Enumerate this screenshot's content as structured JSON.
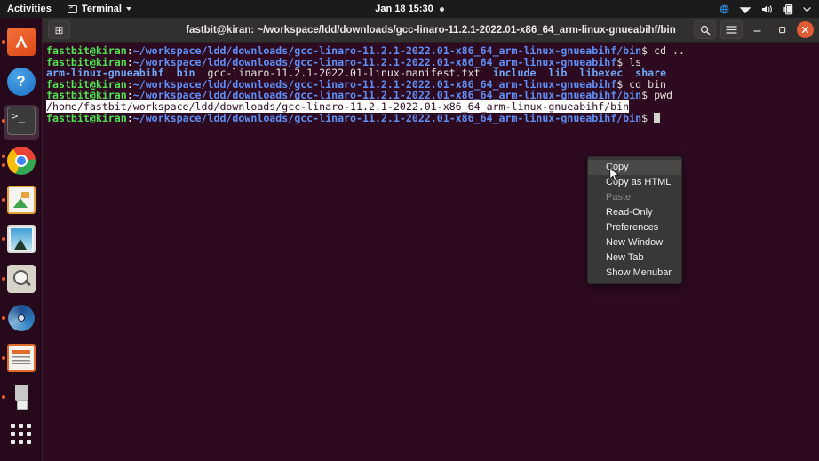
{
  "topbar": {
    "activities": "Activities",
    "app_menu": "Terminal",
    "app_menu_icon": "terminal-icon",
    "caret_icon": "chevron-down-icon",
    "clock": "Jan 18  15:30",
    "clock_dot_icon": "notification-dot-icon",
    "tray": [
      {
        "name": "network-vpn-icon",
        "glyph": "⎈"
      },
      {
        "name": "wifi-icon",
        "glyph": "▼"
      },
      {
        "name": "volume-icon",
        "glyph": "🔊"
      },
      {
        "name": "battery-icon",
        "glyph": "❙"
      },
      {
        "name": "system-menu-caret-icon",
        "glyph": "▾"
      }
    ]
  },
  "dock": {
    "items": [
      {
        "label": "Ubuntu Software",
        "icon": "ubuntu-software-icon",
        "glyph": "A",
        "running": true,
        "active": false
      },
      {
        "label": "Help",
        "icon": "help-icon",
        "glyph": "?",
        "running": false,
        "active": false
      },
      {
        "label": "Terminal",
        "icon": "terminal-icon",
        "glyph": ">_",
        "running": true,
        "active": true
      },
      {
        "label": "Google Chrome",
        "icon": "chrome-icon",
        "glyph": "",
        "running": true,
        "active": false
      },
      {
        "label": "LibreOffice Draw",
        "icon": "libreoffice-draw-icon",
        "glyph": "",
        "running": true,
        "active": false
      },
      {
        "label": "Image Viewer",
        "icon": "image-viewer-icon",
        "glyph": "",
        "running": true,
        "active": false
      },
      {
        "label": "Magnifier",
        "icon": "magnifier-icon",
        "glyph": "",
        "running": true,
        "active": false
      },
      {
        "label": "Media Player",
        "icon": "spiral-media-icon",
        "glyph": "",
        "running": true,
        "active": false
      },
      {
        "label": "LibreOffice Impress",
        "icon": "libreoffice-impress-icon",
        "glyph": "",
        "running": true,
        "active": false
      },
      {
        "label": "USB Drive",
        "icon": "usb-drive-icon",
        "glyph": "",
        "running": true,
        "active": false
      }
    ],
    "app_grid_label": "Show Applications",
    "app_grid_icon": "app-grid-icon"
  },
  "window": {
    "title": "fastbit@kiran: ~/workspace/ldd/downloads/gcc-linaro-11.2.1-2022.01-x86_64_arm-linux-gnueabihf/bin",
    "new_tab_icon": "new-tab-icon",
    "search_icon": "search-icon",
    "menu_icon": "hamburger-menu-icon",
    "minimize_icon": "minimize-icon",
    "maximize_icon": "maximize-icon",
    "close_icon": "close-icon",
    "new_tab_glyph": "⊞",
    "search_glyph": "⚲",
    "menu_glyph": "≡",
    "minimize_glyph": "–",
    "maximize_glyph": "❑",
    "close_glyph": "×"
  },
  "terminal": {
    "user_host": "fastbit@kiran",
    "lines": [
      {
        "type": "prompt",
        "user": "fastbit@kiran",
        "colon": ":",
        "path": "~/workspace/ldd/downloads/gcc-linaro-11.2.1-2022.01-x86_64_arm-linux-gnueabihf/bin",
        "sigil": "$ ",
        "command": "cd .."
      },
      {
        "type": "prompt",
        "user": "fastbit@kiran",
        "colon": ":",
        "path": "~/workspace/ldd/downloads/gcc-linaro-11.2.1-2022.01-x86_64_arm-linux-gnueabihf",
        "sigil": "$ ",
        "command": "ls"
      },
      {
        "type": "ls-output",
        "entries": [
          {
            "name": "arm-linux-gnueabihf",
            "kind": "dir"
          },
          {
            "name": "bin",
            "kind": "dir"
          },
          {
            "name": "gcc-linaro-11.2.1-2022.01-linux-manifest.txt",
            "kind": "file"
          },
          {
            "name": "include",
            "kind": "dir"
          },
          {
            "name": "lib",
            "kind": "dir"
          },
          {
            "name": "libexec",
            "kind": "dir"
          },
          {
            "name": "share",
            "kind": "dir"
          }
        ]
      },
      {
        "type": "prompt",
        "user": "fastbit@kiran",
        "colon": ":",
        "path": "~/workspace/ldd/downloads/gcc-linaro-11.2.1-2022.01-x86_64_arm-linux-gnueabihf",
        "sigil": "$ ",
        "command": "cd bin"
      },
      {
        "type": "prompt",
        "user": "fastbit@kiran",
        "colon": ":",
        "path": "~/workspace/ldd/downloads/gcc-linaro-11.2.1-2022.01-x86_64_arm-linux-gnueabihf/bin",
        "sigil": "$ ",
        "command": "pwd"
      },
      {
        "type": "output-selected",
        "text": "/home/fastbit/workspace/ldd/downloads/gcc-linaro-11.2.1-2022.01-x86_64_arm-linux-gnueabihf/bin"
      },
      {
        "type": "prompt",
        "user": "fastbit@kiran",
        "colon": ":",
        "path": "~/workspace/ldd/downloads/gcc-linaro-11.2.1-2022.01-x86_64_arm-linux-gnueabihf/bin",
        "sigil": "$ ",
        "command": ""
      }
    ]
  },
  "context_menu": {
    "items": [
      {
        "label": "Copy",
        "state": "highlighted"
      },
      {
        "label": "Copy as HTML",
        "state": "normal"
      },
      {
        "label": "Paste",
        "state": "disabled"
      },
      {
        "label": "Read-Only",
        "state": "normal"
      },
      {
        "label": "Preferences",
        "state": "normal"
      },
      {
        "label": "New Window",
        "state": "normal"
      },
      {
        "label": "New Tab",
        "state": "normal"
      },
      {
        "label": "Show Menubar",
        "state": "normal"
      }
    ]
  },
  "colors": {
    "desktop": "#2c0a1e",
    "terminal_bg": "#2d0a20",
    "topbar_bg": "#1b1b1b",
    "titlebar_bg": "#32302f",
    "menu_bg": "#383838",
    "menu_highlight": "#4b4948",
    "accent_orange": "#e8622a",
    "close_red": "#e25a33",
    "prompt_green": "#4ee44e",
    "prompt_blue": "#5f8ff5",
    "dir_blue": "#6fa8f7",
    "selection_white": "#ffffff"
  }
}
